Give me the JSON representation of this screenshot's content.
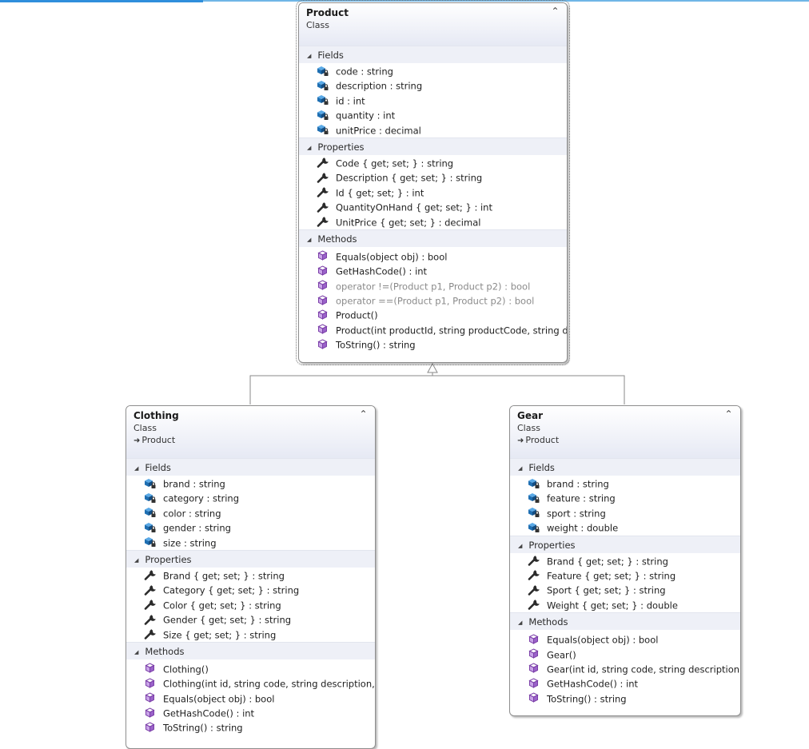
{
  "classes": {
    "product": {
      "name": "Product",
      "kind": "Class",
      "fields_label": "Fields",
      "fields": [
        "code : string",
        "description : string",
        "id : int",
        "quantity : int",
        "unitPrice : decimal"
      ],
      "properties_label": "Properties",
      "properties": [
        "Code { get; set; } : string",
        "Description { get; set; } : string",
        "Id { get; set; } : int",
        "QuantityOnHand { get; set; } : int",
        "UnitPrice { get; set; } : decimal"
      ],
      "methods_label": "Methods",
      "methods": [
        "Equals(object obj) : bool",
        "GetHashCode() : int",
        "operator !=(Product p1, Product p2) : bool",
        "operator ==(Product p1, Product p2) : bool",
        "Product()",
        "Product(int productId, string productCode, string d...",
        "ToString() : string"
      ]
    },
    "clothing": {
      "name": "Clothing",
      "kind": "Class",
      "base": "Product",
      "fields_label": "Fields",
      "fields": [
        "brand : string",
        "category : string",
        "color : string",
        "gender : string",
        "size : string"
      ],
      "properties_label": "Properties",
      "properties": [
        "Brand { get; set; } : string",
        "Category { get; set; } : string",
        "Color { get; set; } : string",
        "Gender { get; set; } : string",
        "Size { get; set; } : string"
      ],
      "methods_label": "Methods",
      "methods": [
        "Clothing()",
        "Clothing(int id, string code, string description,...",
        "Equals(object obj) : bool",
        "GetHashCode() : int",
        "ToString() : string"
      ]
    },
    "gear": {
      "name": "Gear",
      "kind": "Class",
      "base": "Product",
      "fields_label": "Fields",
      "fields": [
        "brand : string",
        "feature : string",
        "sport : string",
        "weight : double"
      ],
      "properties_label": "Properties",
      "properties": [
        "Brand { get; set; } : string",
        "Feature { get; set; } : string",
        "Sport { get; set; } : string",
        "Weight { get; set; } : double"
      ],
      "methods_label": "Methods",
      "methods": [
        "Equals(object obj) : bool",
        "Gear()",
        "Gear(int id, string code, string description,...",
        "GetHashCode() : int",
        "ToString() : string"
      ]
    }
  },
  "icons": {
    "collapse": "double-chevron-up-icon",
    "section_toggle": "triangle-expanded-icon",
    "field": "private-field-icon",
    "property": "wrench-property-icon",
    "method": "method-cube-icon",
    "inherits": "inheritance-arrow-icon"
  },
  "colors": {
    "header_gradient_end": "#e6e9f4",
    "section_header": "#eef0f7",
    "field_icon": "#1f6fb2",
    "method_icon": "#7b3fa8",
    "dim_text": "#8b8b8b"
  }
}
